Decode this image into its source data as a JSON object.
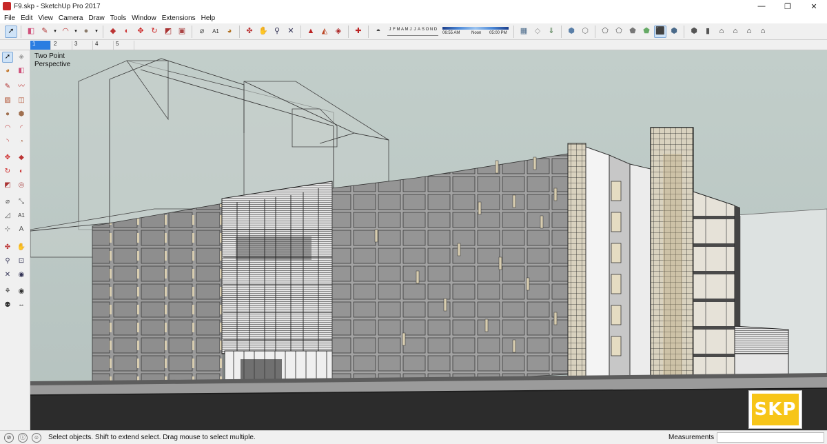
{
  "window": {
    "title": "F9.skp - SketchUp Pro 2017",
    "controls": {
      "minimize": "—",
      "maximize": "❐",
      "close": "✕"
    }
  },
  "menu": [
    "File",
    "Edit",
    "View",
    "Camera",
    "Draw",
    "Tools",
    "Window",
    "Extensions",
    "Help"
  ],
  "toolbar": {
    "months": [
      "J",
      "F",
      "M",
      "A",
      "M",
      "J",
      "J",
      "A",
      "S",
      "O",
      "N",
      "D"
    ],
    "time_start": "06:55 AM",
    "time_mid": "Noon",
    "time_end": "05:00 PM"
  },
  "scenes": [
    "1",
    "2",
    "3",
    "4",
    "5"
  ],
  "active_scene": "1",
  "viewport": {
    "camera_label": "Two Point\nPerspective",
    "badge": "SKP"
  },
  "status": {
    "message": "Select objects. Shift to extend select. Drag mouse to select multiple.",
    "measurements_label": "Measurements",
    "measurements_value": ""
  },
  "colors": {
    "sky": "#bcc9c6",
    "ground": "#5d5d5d",
    "road": "#2c2c2c",
    "facade_panel": "#8e8e8e",
    "accent": "#2a7de1",
    "badge": "#f7c518"
  }
}
